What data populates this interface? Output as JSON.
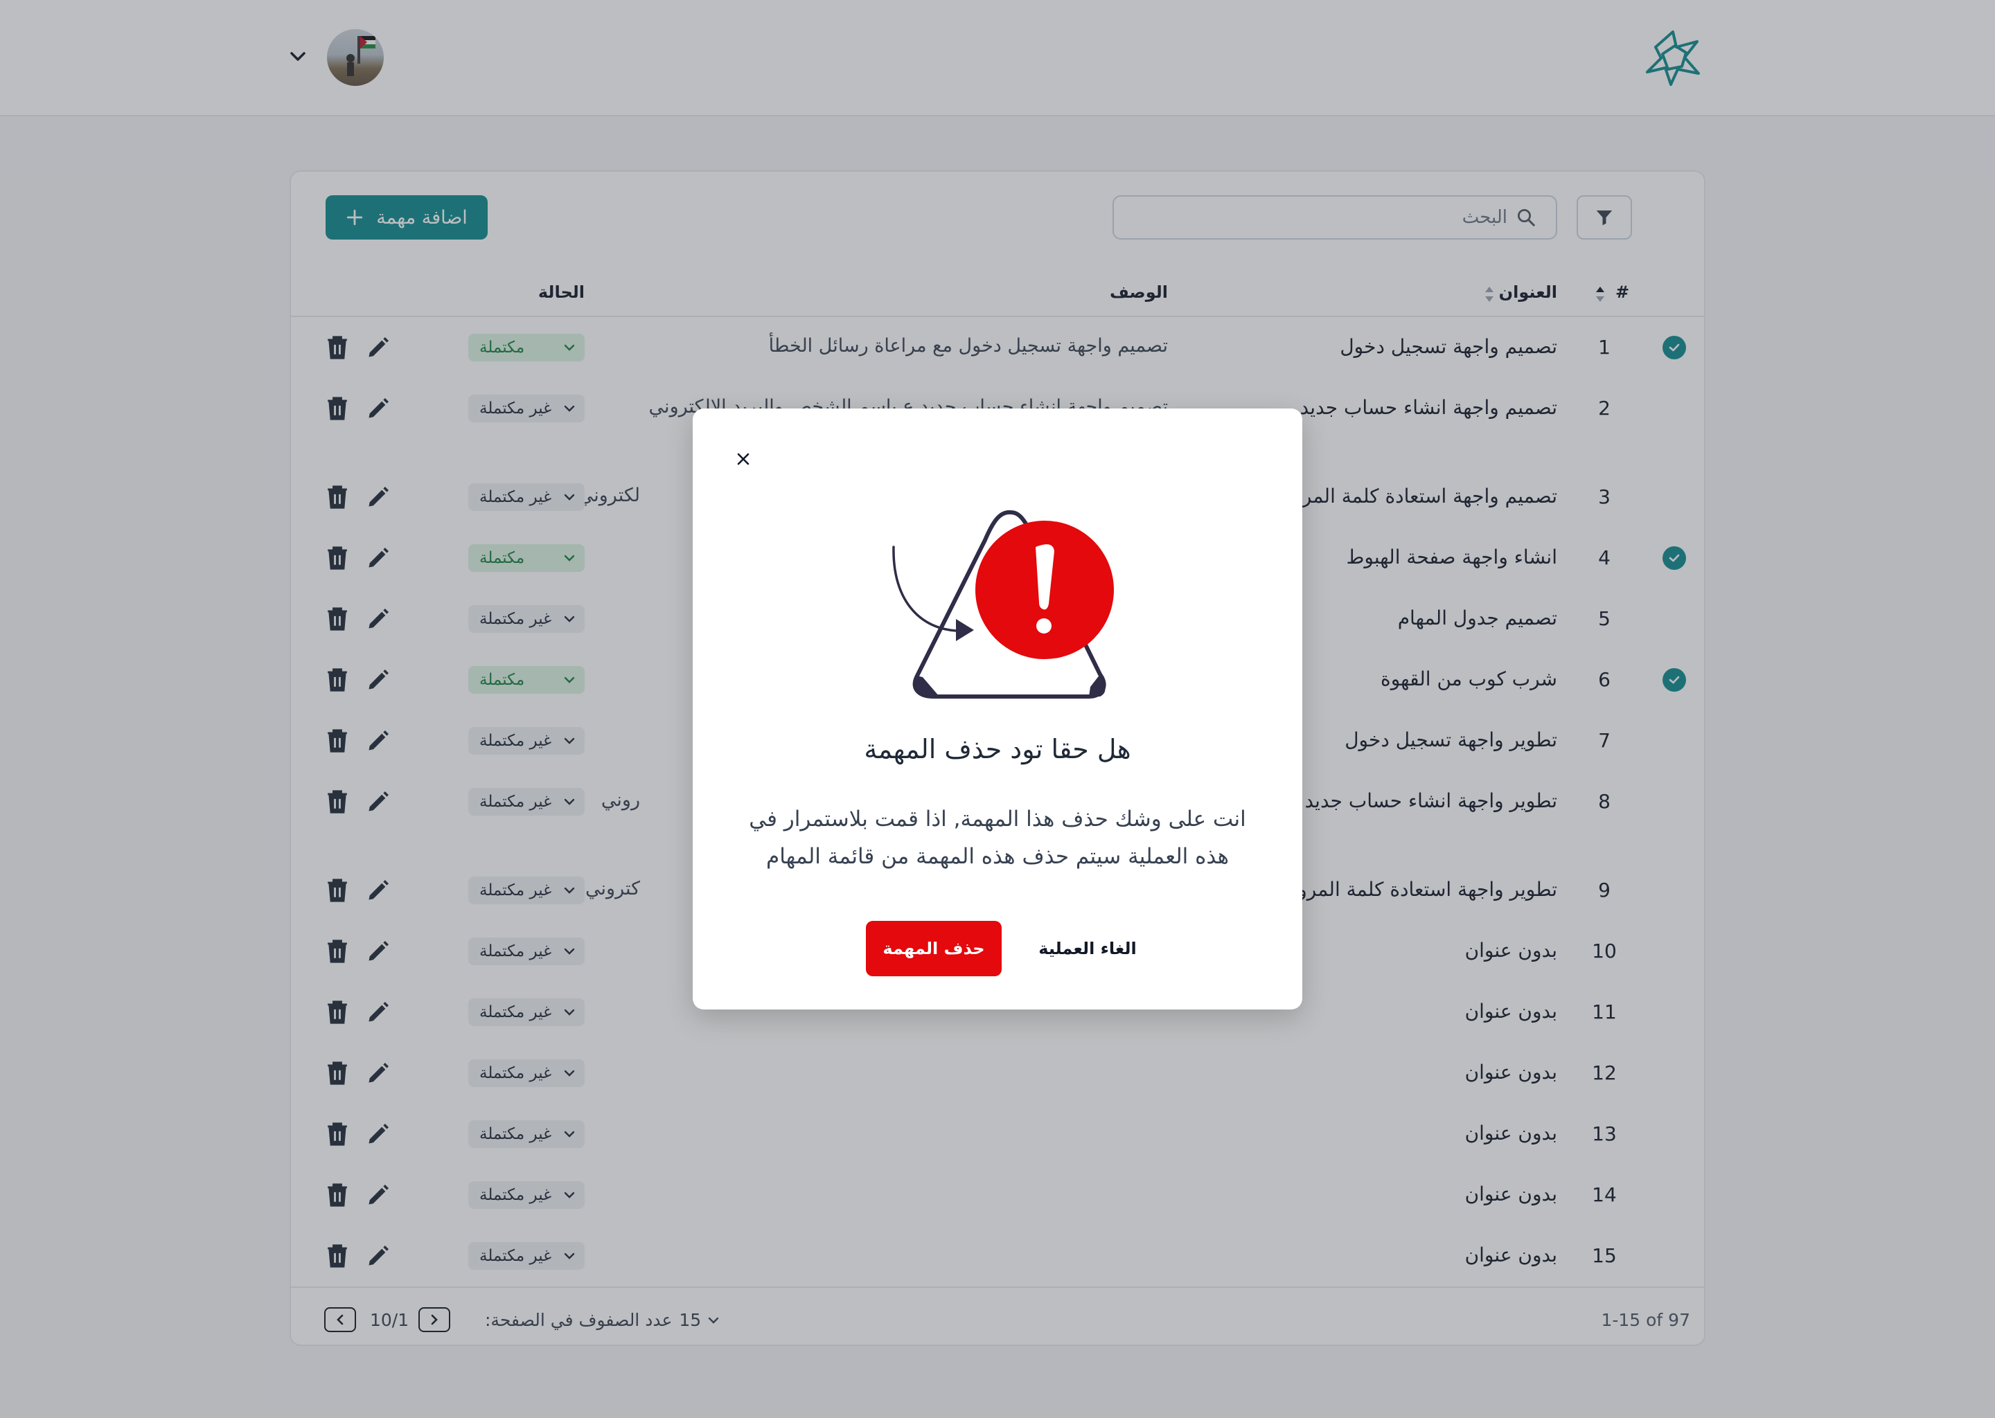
{
  "header": {
    "logo_icon": "star-knot-logo-icon",
    "user_avatar": "user-avatar"
  },
  "toolbar": {
    "search_placeholder": "البحث",
    "add_label": "اضافة مهمة"
  },
  "table": {
    "columns": {
      "index": "#",
      "title": "العنوان",
      "description": "الوصف",
      "status": "الحالة"
    },
    "rows": [
      {
        "num": "1",
        "title": "تصميم واجهة تسجيل دخول",
        "desc": "تصميم واجهة تسجيل دخول مع مراعاة رسائل الخطأ",
        "status": "مكتملة",
        "done": true
      },
      {
        "num": "2",
        "title": "تصميم واجهة انشاء حساب جديد",
        "desc": "تصميم واجهة انشاء حساب جديد ع باسم الشخص والبريد الالكتروني",
        "status": "غير مكتملة",
        "done": false
      },
      {
        "num": "3",
        "title": "تصميم واجهة استعادة كلمة المرور",
        "desc": "لكتروني",
        "status": "غير مكتملة",
        "done": false
      },
      {
        "num": "4",
        "title": "انشاء واجهة صفحة الهبوط",
        "desc": "",
        "status": "مكتملة",
        "done": true
      },
      {
        "num": "5",
        "title": "تصميم جدول المهام",
        "desc": "",
        "status": "غير مكتملة",
        "done": false
      },
      {
        "num": "6",
        "title": "شرب كوب من القهوة",
        "desc": "",
        "status": "مكتملة",
        "done": true
      },
      {
        "num": "7",
        "title": "تطوير واجهة تسجيل دخول",
        "desc": "",
        "status": "غير مكتملة",
        "done": false
      },
      {
        "num": "8",
        "title": "تطوير واجهة انشاء حساب جديد",
        "desc": "روني",
        "status": "غير مكتملة",
        "done": false
      },
      {
        "num": "9",
        "title": "تطوير واجهة استعادة كلمة المرور",
        "desc": "كتروني",
        "status": "غير مكتملة",
        "done": false
      },
      {
        "num": "10",
        "title": "بدون عنوان",
        "desc": "",
        "status": "غير مكتملة",
        "done": false
      },
      {
        "num": "11",
        "title": "بدون عنوان",
        "desc": "",
        "status": "غير مكتملة",
        "done": false
      },
      {
        "num": "12",
        "title": "بدون عنوان",
        "desc": "",
        "status": "غير مكتملة",
        "done": false
      },
      {
        "num": "13",
        "title": "بدون عنوان",
        "desc": "",
        "status": "غير مكتملة",
        "done": false
      },
      {
        "num": "14",
        "title": "بدون عنوان",
        "desc": "",
        "status": "غير مكتملة",
        "done": false
      },
      {
        "num": "15",
        "title": "بدون عنوان",
        "desc": "",
        "status": "غير مكتملة",
        "done": false
      }
    ]
  },
  "footer": {
    "range": "1-15 of 97",
    "rows_per_page_label": "عدد الصفوف في الصفحة:",
    "rows_per_page_value": "15",
    "page_info": "10/1"
  },
  "modal": {
    "title": "هل حقا تود حذف المهمة",
    "body": "انت على وشك حذف هذا المهمة, اذا قمت بلاستمرار في هذه العملية سيتم حذف هذه المهمة من قائمة المهام",
    "confirm_label": "حذف المهمة",
    "cancel_label": "الغاء العملية",
    "illustration": "warning-triangle-icon"
  },
  "colors": {
    "accent": "#0f8b8d",
    "danger": "#e3090c",
    "done_bg": "#dcf3e2",
    "done_text": "#15803d"
  }
}
